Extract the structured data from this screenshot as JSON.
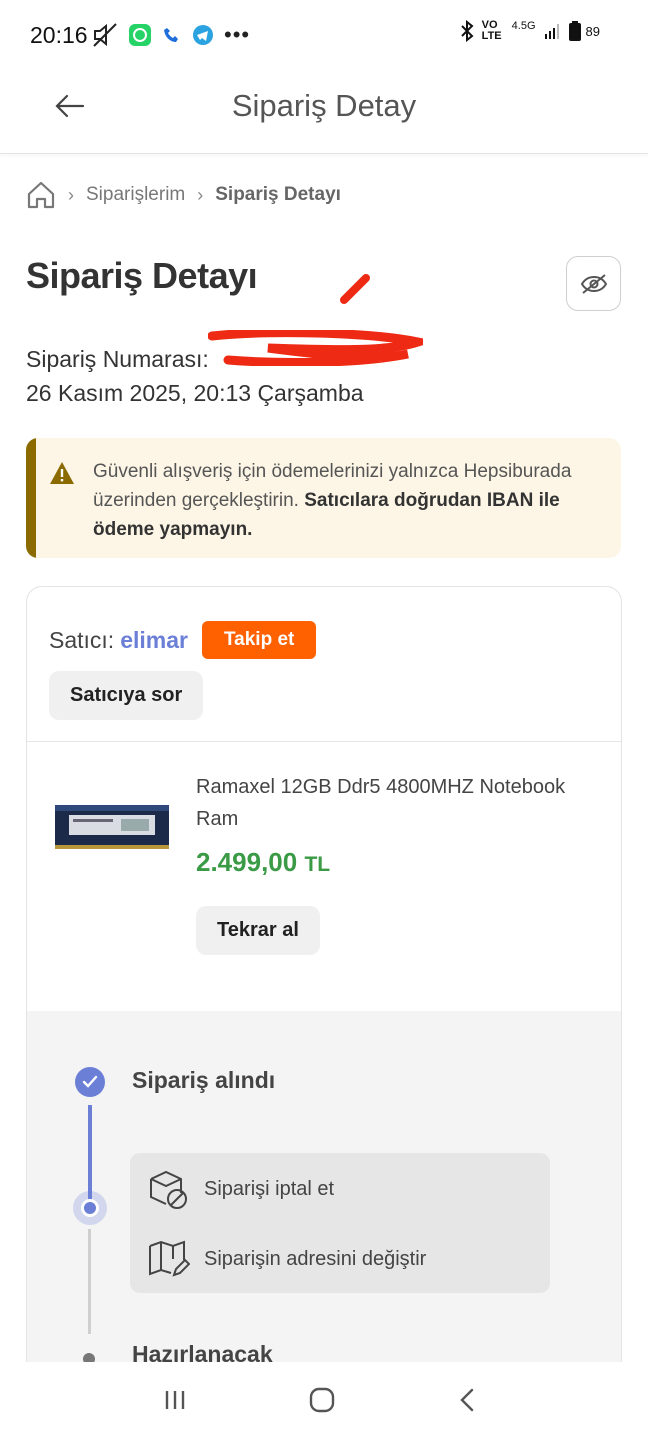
{
  "status_bar": {
    "time": "20:16",
    "network": "4.5G",
    "volte": "VO LTE",
    "battery": "89"
  },
  "header": {
    "title": "Sipariş Detay"
  },
  "breadcrumb": {
    "items": [
      "Siparişlerim",
      "Sipariş Detayı"
    ]
  },
  "order": {
    "title": "Sipariş Detayı",
    "number_label": "Sipariş Numarası:",
    "date": "26 Kasım 2025, 20:13 Çarşamba"
  },
  "warning": {
    "text_normal": "Güvenli alışveriş için ödemelerinizi yalnızca Hepsiburada üzerinden gerçekleştirin. ",
    "text_bold": "Satıcılara doğrudan IBAN ile ödeme yapmayın."
  },
  "seller": {
    "label": "Satıcı:",
    "name": "elimar",
    "follow_label": "Takip et",
    "ask_label": "Satıcıya sor"
  },
  "product": {
    "name": "Ramaxel 12GB Ddr5 4800MHZ Notebook Ram",
    "price": "2.499,00",
    "currency": "TL",
    "rebuy_label": "Tekrar al"
  },
  "timeline": {
    "step1": "Sipariş alındı",
    "step2": "Hazırlanacak",
    "actions": {
      "cancel": "Siparişi iptal et",
      "change_address": "Siparişin adresini değiştir"
    }
  },
  "colors": {
    "accent": "#6b7fd7",
    "orange": "#ff6000",
    "price_green": "#3a9a45",
    "warning_bg": "#fdf6e6"
  }
}
